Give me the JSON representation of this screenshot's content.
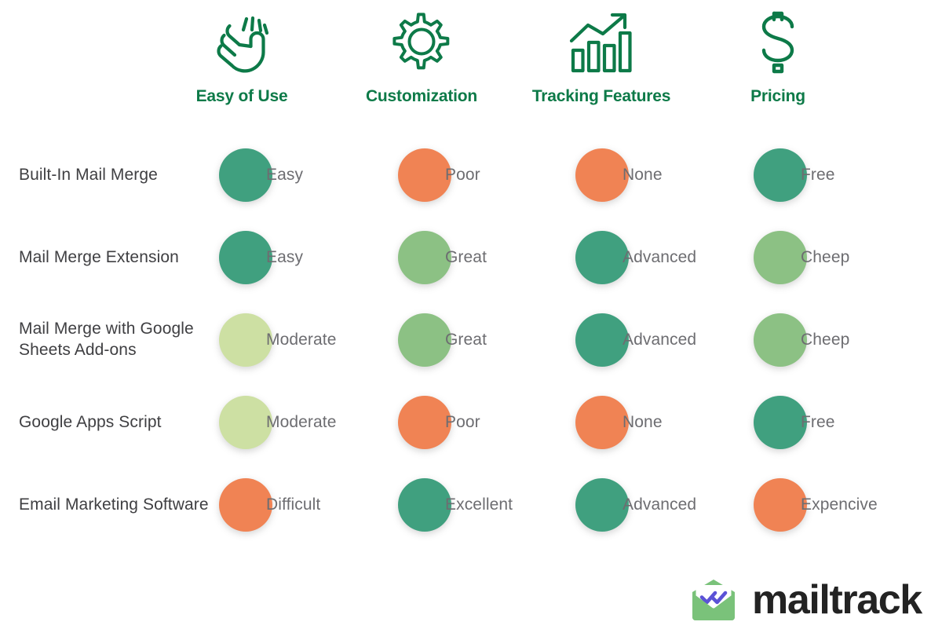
{
  "background_color": "#ffffff",
  "theme": {
    "header_text_color": "#0d7a48",
    "row_label_color": "#3f3f42",
    "cell_text_color": "#6d6d71",
    "wordmark_color": "#232323"
  },
  "columns": [
    {
      "label": "Easy of Use",
      "icon": "hand-ok-icon"
    },
    {
      "label": "Customization",
      "icon": "gear-icon"
    },
    {
      "label": "Tracking Features",
      "icon": "bar-chart-growth-icon"
    },
    {
      "label": "Pricing",
      "icon": "dollar-sign-icon"
    }
  ],
  "legend_colors": {
    "excellent_green": "#40a07f",
    "good_green": "#8cc184",
    "moderate_lime": "#cde0a3",
    "poor_orange": "#f08354"
  },
  "rows": [
    {
      "label": "Built-In Mail Merge",
      "cells": [
        {
          "value": "Easy",
          "color": "#40a07f",
          "rating": "excellent"
        },
        {
          "value": "Poor",
          "color": "#f08354",
          "rating": "poor"
        },
        {
          "value": "None",
          "color": "#f08354",
          "rating": "poor"
        },
        {
          "value": "Free",
          "color": "#40a07f",
          "rating": "excellent"
        }
      ]
    },
    {
      "label": "Mail Merge Extension",
      "cells": [
        {
          "value": "Easy",
          "color": "#40a07f",
          "rating": "excellent"
        },
        {
          "value": "Great",
          "color": "#8cc184",
          "rating": "good"
        },
        {
          "value": "Advanced",
          "color": "#40a07f",
          "rating": "excellent"
        },
        {
          "value": "Cheep",
          "color": "#8cc184",
          "rating": "good"
        }
      ]
    },
    {
      "label": "Mail Merge with Google Sheets Add-ons",
      "cells": [
        {
          "value": "Moderate",
          "color": "#cde0a3",
          "rating": "moderate"
        },
        {
          "value": "Great",
          "color": "#8cc184",
          "rating": "good"
        },
        {
          "value": "Advanced",
          "color": "#40a07f",
          "rating": "excellent"
        },
        {
          "value": "Cheep",
          "color": "#8cc184",
          "rating": "good"
        }
      ]
    },
    {
      "label": "Google Apps Script",
      "cells": [
        {
          "value": "Moderate",
          "color": "#cde0a3",
          "rating": "moderate"
        },
        {
          "value": "Poor",
          "color": "#f08354",
          "rating": "poor"
        },
        {
          "value": "None",
          "color": "#f08354",
          "rating": "poor"
        },
        {
          "value": "Free",
          "color": "#40a07f",
          "rating": "excellent"
        }
      ]
    },
    {
      "label": "Email Marketing Software",
      "cells": [
        {
          "value": "Difficult",
          "color": "#f08354",
          "rating": "poor"
        },
        {
          "value": "Excellent",
          "color": "#40a07f",
          "rating": "excellent"
        },
        {
          "value": "Advanced",
          "color": "#40a07f",
          "rating": "excellent"
        },
        {
          "value": "Expencive",
          "color": "#f08354",
          "rating": "poor"
        }
      ]
    }
  ],
  "logo": {
    "wordmark": "mailtrack",
    "mark_icon": "envelope-double-check-icon",
    "envelope_color": "#7ac27a",
    "check_color": "#5b52d6"
  }
}
